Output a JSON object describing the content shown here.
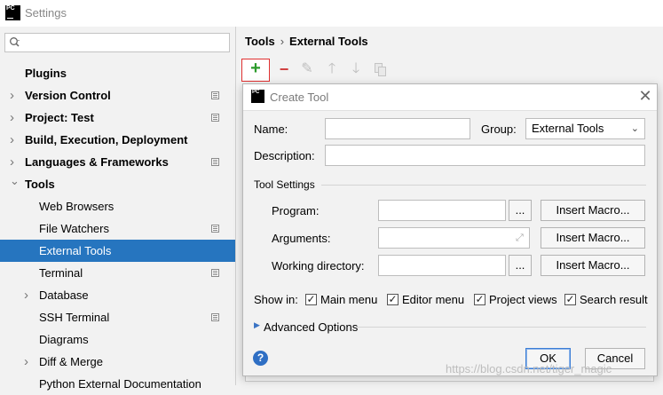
{
  "window": {
    "logo": "PC",
    "title": "Settings"
  },
  "search": {
    "placeholder": ""
  },
  "tree": [
    {
      "label": "Plugins",
      "bold": true,
      "arrow": "",
      "indent": 0,
      "cfg": false
    },
    {
      "label": "Version Control",
      "bold": true,
      "arrow": "right",
      "indent": 0,
      "cfg": true
    },
    {
      "label": "Project: Test",
      "bold": true,
      "arrow": "right",
      "indent": 0,
      "cfg": true
    },
    {
      "label": "Build, Execution, Deployment",
      "bold": true,
      "arrow": "right",
      "indent": 0,
      "cfg": false
    },
    {
      "label": "Languages & Frameworks",
      "bold": true,
      "arrow": "right",
      "indent": 0,
      "cfg": true
    },
    {
      "label": "Tools",
      "bold": true,
      "arrow": "down",
      "indent": 0,
      "cfg": false
    },
    {
      "label": "Web Browsers",
      "bold": false,
      "arrow": "",
      "indent": 1,
      "cfg": false
    },
    {
      "label": "File Watchers",
      "bold": false,
      "arrow": "",
      "indent": 1,
      "cfg": true
    },
    {
      "label": "External Tools",
      "bold": false,
      "arrow": "",
      "indent": 1,
      "cfg": false,
      "selected": true
    },
    {
      "label": "Terminal",
      "bold": false,
      "arrow": "",
      "indent": 1,
      "cfg": true
    },
    {
      "label": "Database",
      "bold": false,
      "arrow": "right",
      "indent": 1,
      "cfg": false
    },
    {
      "label": "SSH Terminal",
      "bold": false,
      "arrow": "",
      "indent": 1,
      "cfg": true
    },
    {
      "label": "Diagrams",
      "bold": false,
      "arrow": "",
      "indent": 1,
      "cfg": false
    },
    {
      "label": "Diff & Merge",
      "bold": false,
      "arrow": "right",
      "indent": 1,
      "cfg": false
    },
    {
      "label": "Python External Documentation",
      "bold": false,
      "arrow": "",
      "indent": 1,
      "cfg": false
    }
  ],
  "breadcrumb": {
    "parent": "Tools",
    "separator": "›",
    "current": "External Tools"
  },
  "toolbar": {
    "add": "+",
    "remove": "−",
    "edit": "✎",
    "up": "🡑",
    "down": "🡓"
  },
  "dialog": {
    "logo": "PC",
    "title": "Create Tool",
    "close": "✕",
    "name_label": "Name:",
    "name_value": "",
    "group_label": "Group:",
    "group_value": "External Tools",
    "description_label": "Description:",
    "description_value": "",
    "section_title": "Tool Settings",
    "program_label": "Program:",
    "program_value": "",
    "arguments_label": "Arguments:",
    "arguments_value": "",
    "workdir_label": "Working directory:",
    "workdir_value": "",
    "browse": "...",
    "insert_macro": "Insert Macro...",
    "show_in_label": "Show in:",
    "checkboxes": [
      {
        "label": "Main menu",
        "checked": true
      },
      {
        "label": "Editor menu",
        "checked": true
      },
      {
        "label": "Project views",
        "checked": true
      },
      {
        "label": "Search result",
        "checked": true
      }
    ],
    "advanced_label": "Advanced Options",
    "help": "?",
    "ok": "OK",
    "cancel": "Cancel"
  },
  "watermark": "https://blog.csdn.net/tiger_magic"
}
